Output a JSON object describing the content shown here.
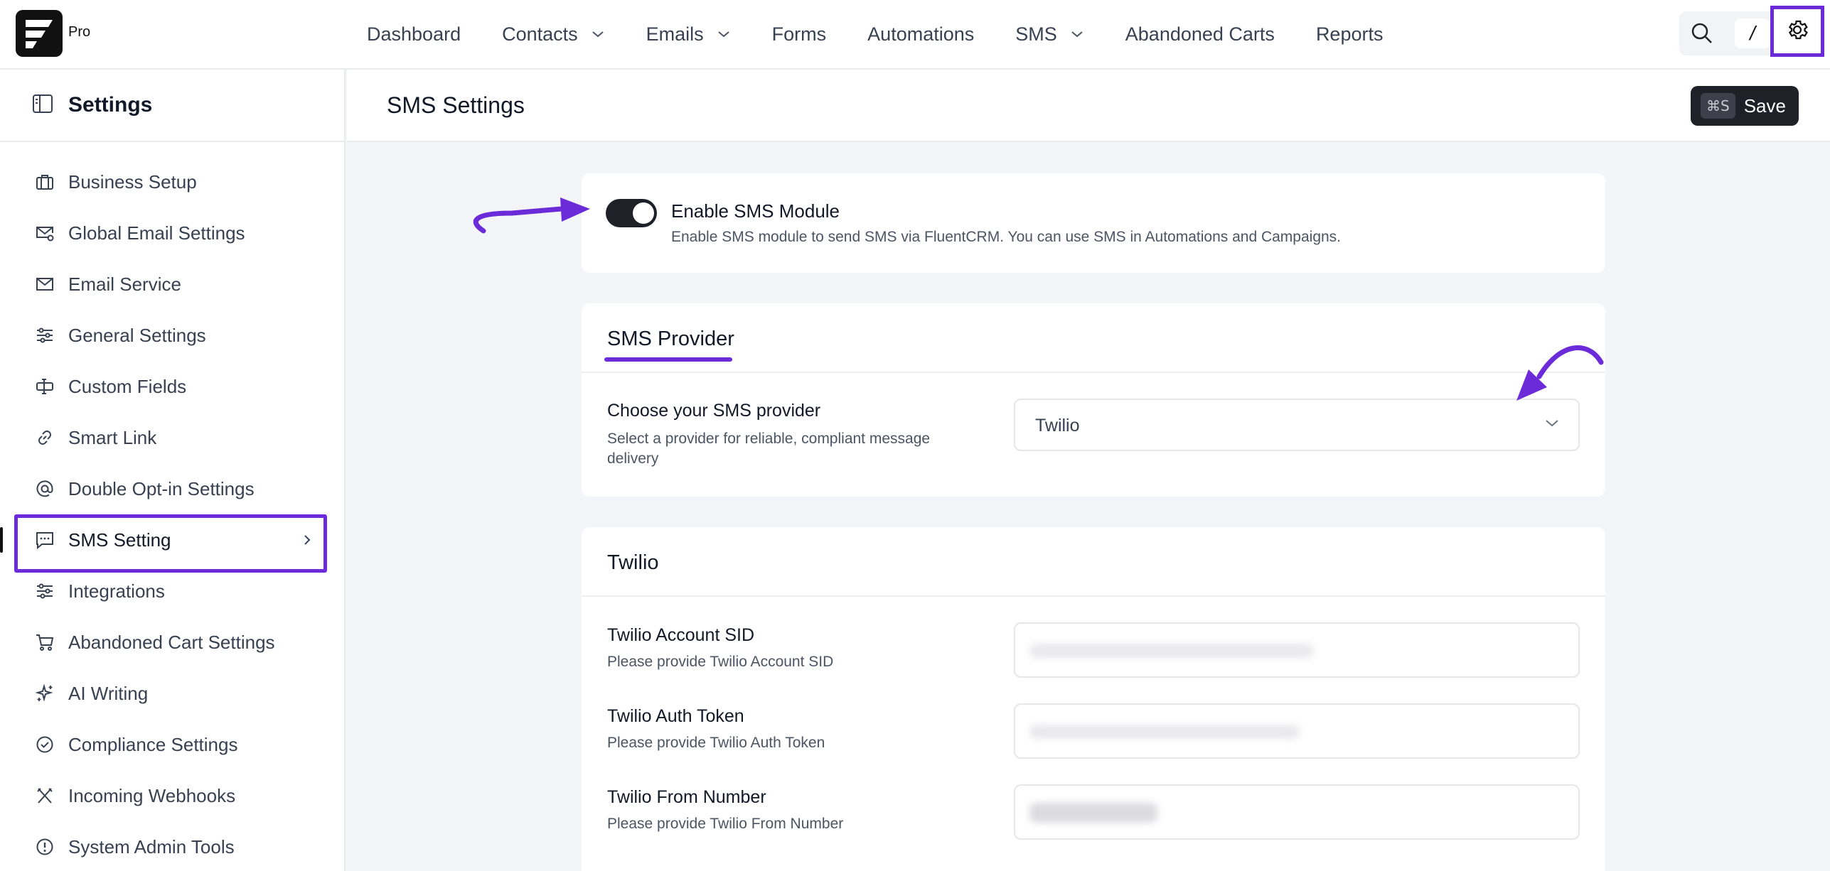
{
  "brand": {
    "badge": "Pro"
  },
  "nav": {
    "items": [
      {
        "label": "Dashboard",
        "has_dropdown": false
      },
      {
        "label": "Contacts",
        "has_dropdown": true
      },
      {
        "label": "Emails",
        "has_dropdown": true
      },
      {
        "label": "Forms",
        "has_dropdown": false
      },
      {
        "label": "Automations",
        "has_dropdown": false
      },
      {
        "label": "SMS",
        "has_dropdown": true
      },
      {
        "label": "Abandoned Carts",
        "has_dropdown": false
      },
      {
        "label": "Reports",
        "has_dropdown": false
      }
    ],
    "shortcut_key": "/"
  },
  "sidebar": {
    "title": "Settings",
    "items": [
      {
        "label": "Business Setup",
        "icon": "briefcase-icon"
      },
      {
        "label": "Global Email Settings",
        "icon": "mail-gear-icon"
      },
      {
        "label": "Email Service",
        "icon": "mail-icon"
      },
      {
        "label": "General Settings",
        "icon": "sliders-icon"
      },
      {
        "label": "Custom Fields",
        "icon": "text-cursor-icon"
      },
      {
        "label": "Smart Link",
        "icon": "link-icon"
      },
      {
        "label": "Double Opt-in Settings",
        "icon": "at-icon"
      },
      {
        "label": "SMS Setting",
        "icon": "message-icon",
        "active": true
      },
      {
        "label": "Integrations",
        "icon": "sliders-icon"
      },
      {
        "label": "Abandoned Cart Settings",
        "icon": "cart-icon"
      },
      {
        "label": "AI Writing",
        "icon": "sparkles-icon"
      },
      {
        "label": "Compliance Settings",
        "icon": "check-circle-icon"
      },
      {
        "label": "Incoming Webhooks",
        "icon": "webhook-icon"
      },
      {
        "label": "System Admin Tools",
        "icon": "alert-circle-icon"
      }
    ]
  },
  "main": {
    "title": "SMS Settings",
    "save": {
      "shortcut": "⌘S",
      "label": "Save"
    }
  },
  "module": {
    "label": "Enable SMS Module",
    "description": "Enable SMS module to send SMS via FluentCRM. You can use SMS in Automations and Campaigns.",
    "enabled": true
  },
  "provider": {
    "section_title": "SMS Provider",
    "field_label": "Choose your SMS provider",
    "field_desc": "Select a provider for reliable, compliant message delivery",
    "selected": "Twilio"
  },
  "twilio": {
    "section_title": "Twilio",
    "fields": [
      {
        "label": "Twilio Account SID",
        "desc": "Please provide Twilio Account SID"
      },
      {
        "label": "Twilio Auth Token",
        "desc": "Please provide Twilio Auth Token"
      },
      {
        "label": "Twilio From Number",
        "desc": "Please provide Twilio From Number"
      }
    ]
  },
  "colors": {
    "accent": "#6c2bd9",
    "dark": "#1f2129"
  }
}
